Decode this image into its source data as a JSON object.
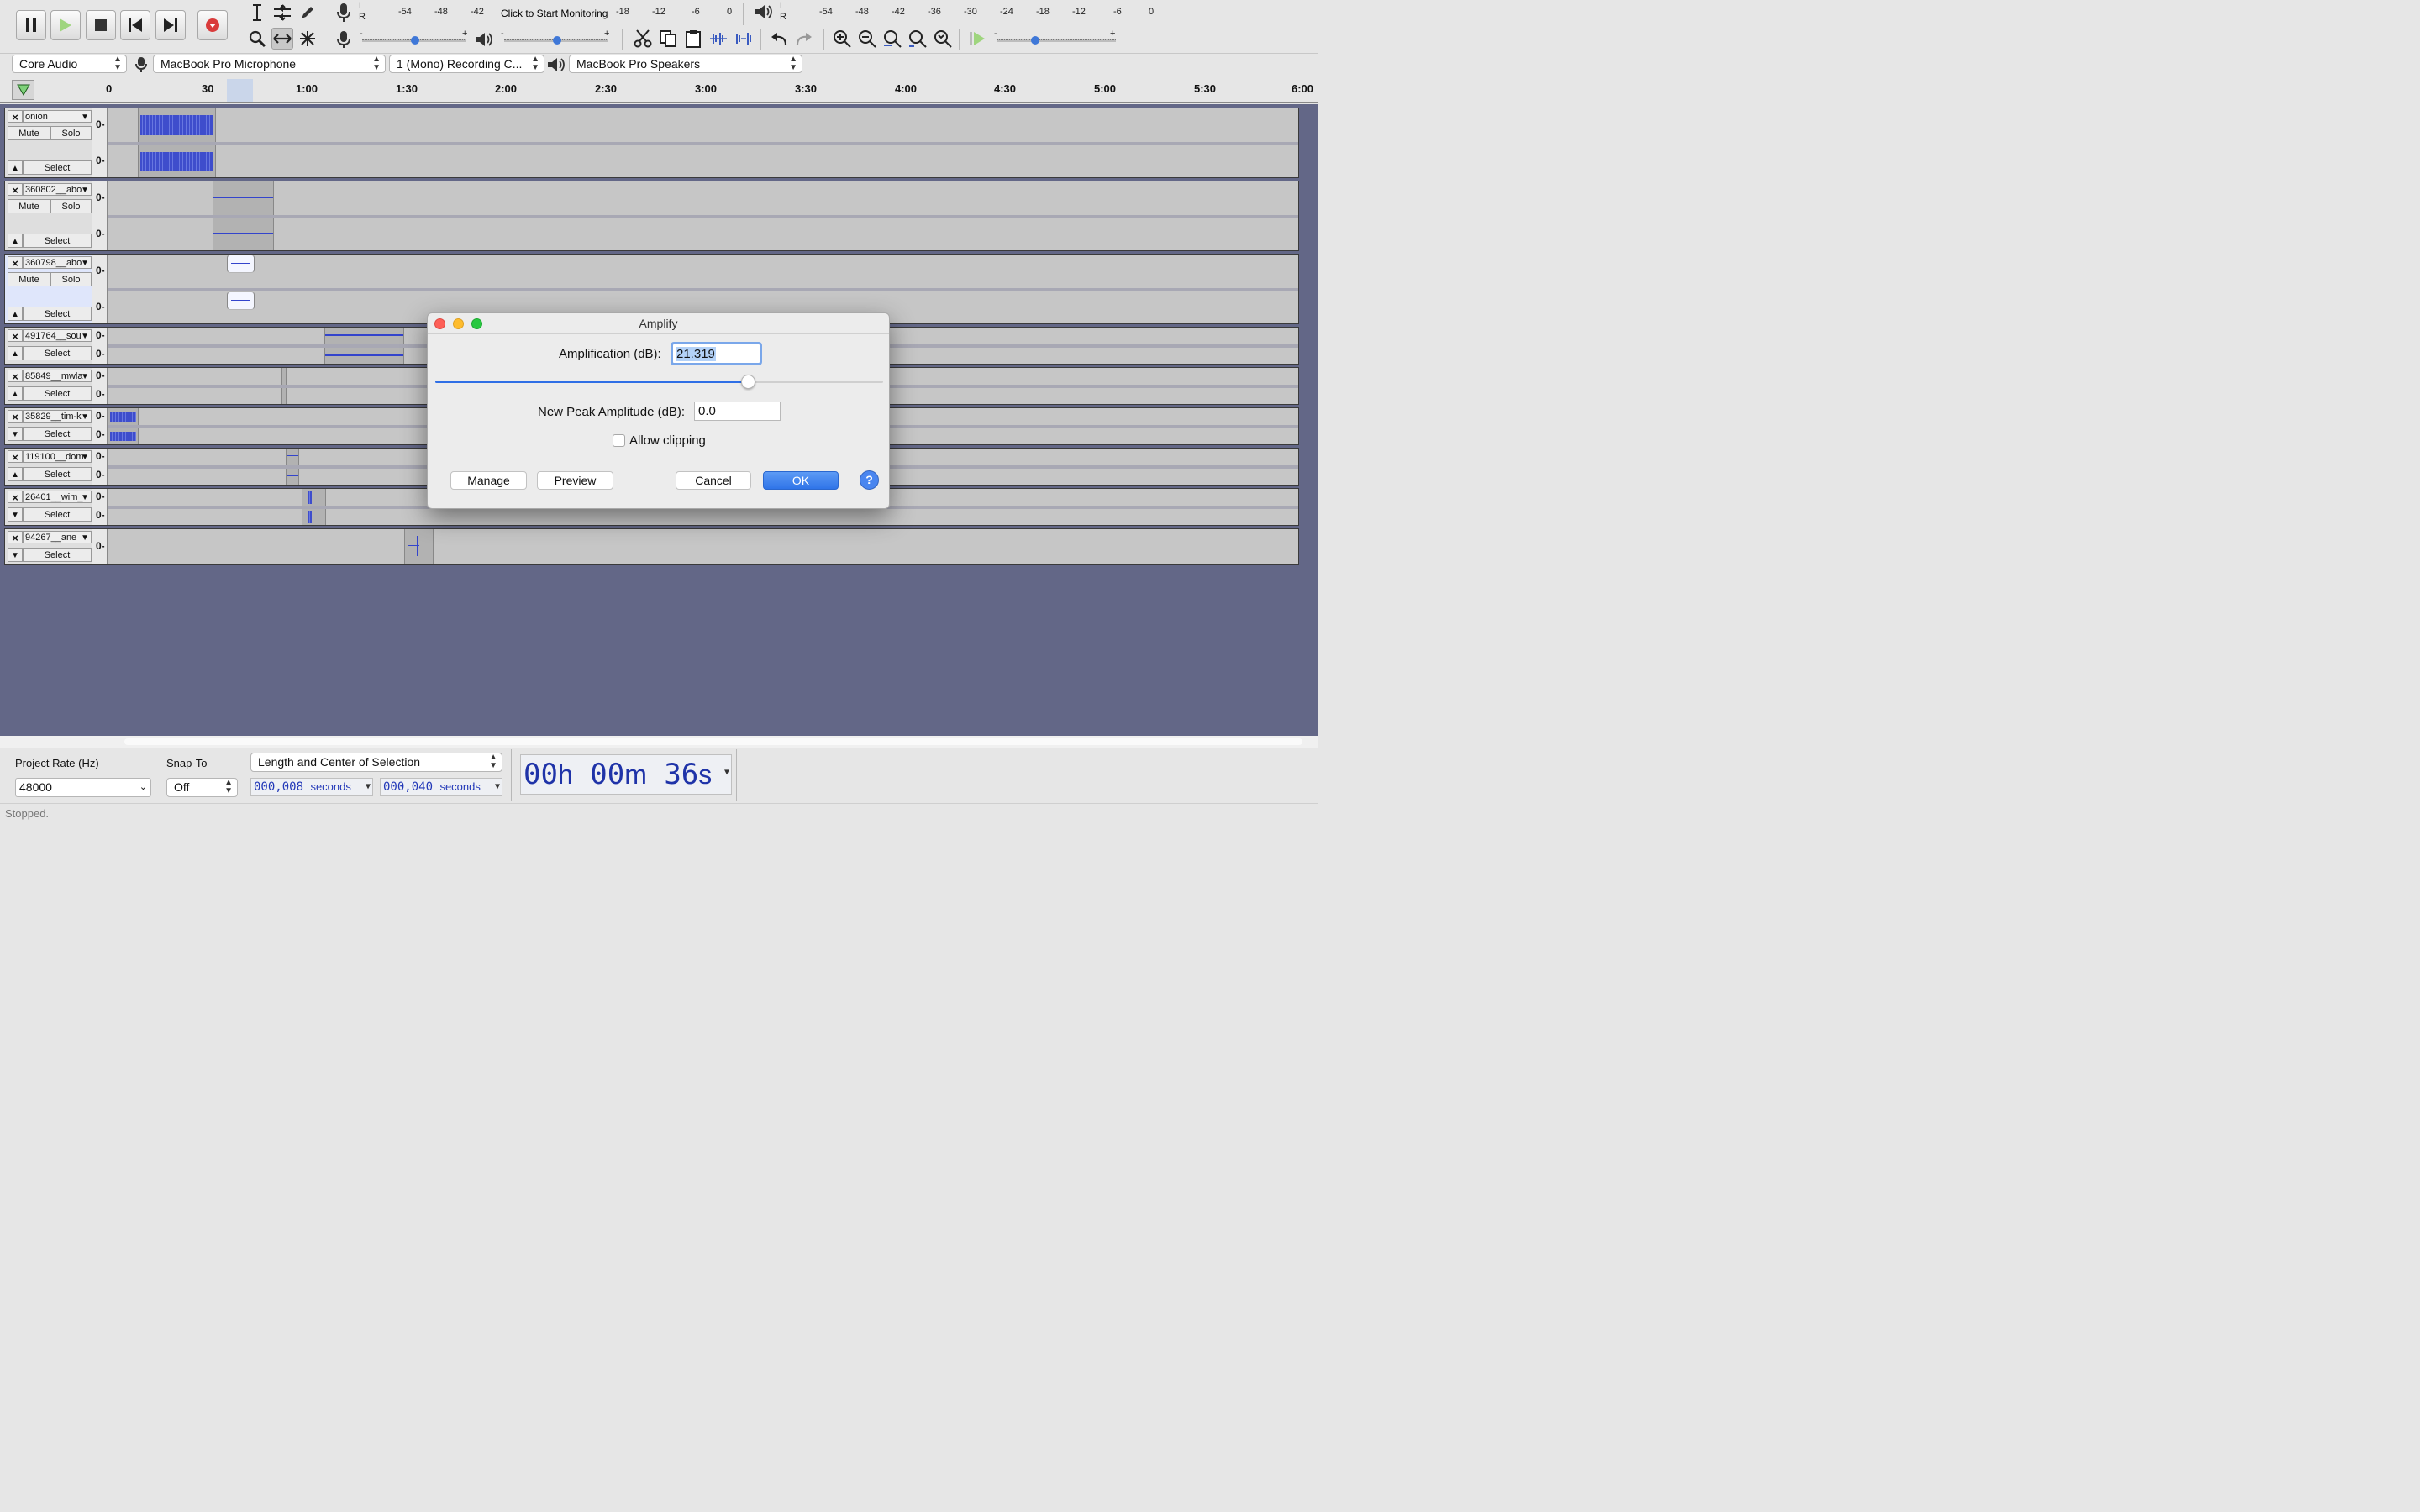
{
  "transport": {
    "pause": "pause-icon",
    "play": "play-icon",
    "stop": "stop-icon",
    "skip_start": "skip-to-start-icon",
    "skip_end": "skip-to-end-icon",
    "record": "record-icon"
  },
  "record_meter": {
    "channels": [
      "L",
      "R"
    ],
    "ticks": [
      "-54",
      "-48",
      "-42",
      "-18",
      "-12",
      "-6",
      "0"
    ],
    "monitor_label": "Click to Start Monitoring"
  },
  "playback_meter": {
    "channels": [
      "L",
      "R"
    ],
    "ticks": [
      "-54",
      "-48",
      "-42",
      "-36",
      "-30",
      "-24",
      "-18",
      "-12",
      "-6",
      "0"
    ]
  },
  "mixer": {
    "minus": "-",
    "plus": "+"
  },
  "devices": {
    "host": "Core Audio",
    "recording_device": "MacBook Pro Microphone",
    "channels": "1 (Mono) Recording C...",
    "playback_device": "MacBook Pro Speakers"
  },
  "timeline": {
    "ticks": [
      "0",
      "30",
      "1:00",
      "1:30",
      "2:00",
      "2:30",
      "3:00",
      "3:30",
      "4:00",
      "4:30",
      "5:00",
      "5:30",
      "6:00"
    ]
  },
  "track_controls": {
    "close": "×",
    "mute": "Mute",
    "solo": "Solo",
    "select": "Select",
    "level": "0-"
  },
  "tracks": [
    {
      "name": "onion"
    },
    {
      "name": "360802__abo"
    },
    {
      "name": "360798__abo"
    },
    {
      "name": "491764__sou"
    },
    {
      "name": "85849__mwla"
    },
    {
      "name": "35829__tim-k"
    },
    {
      "name": "119100__dom"
    },
    {
      "name": "26401__wim_"
    },
    {
      "name": "94267__ane"
    }
  ],
  "dialog": {
    "title": "Amplify",
    "amplification_label": "Amplification (dB):",
    "amplification_value": "21.319",
    "slider_level_fraction": 0.7,
    "peak_label": "New Peak Amplitude (dB):",
    "peak_value": "0.0",
    "allow_clipping_label": "Allow clipping",
    "allow_clipping_checked": false,
    "manage": "Manage",
    "preview": "Preview",
    "cancel": "Cancel",
    "ok": "OK",
    "help": "?"
  },
  "selection_bar": {
    "project_rate_label": "Project Rate (Hz)",
    "project_rate": "48000",
    "snap_label": "Snap-To",
    "snap_value": "Off",
    "selection_mode": "Length and Center of Selection",
    "length_digits": "000,008",
    "length_unit": "seconds",
    "center_digits": "000,040",
    "center_unit": "seconds"
  },
  "time_display": {
    "h": "00",
    "h_unit": "h",
    "m": "00",
    "m_unit": "m",
    "s": "36",
    "s_unit": "s"
  },
  "status": "Stopped.",
  "colors": {
    "background_area": "#636787",
    "accent_blue": "#2f6fe6",
    "waveform": "#3344cc",
    "record_red": "#d93b3b"
  }
}
